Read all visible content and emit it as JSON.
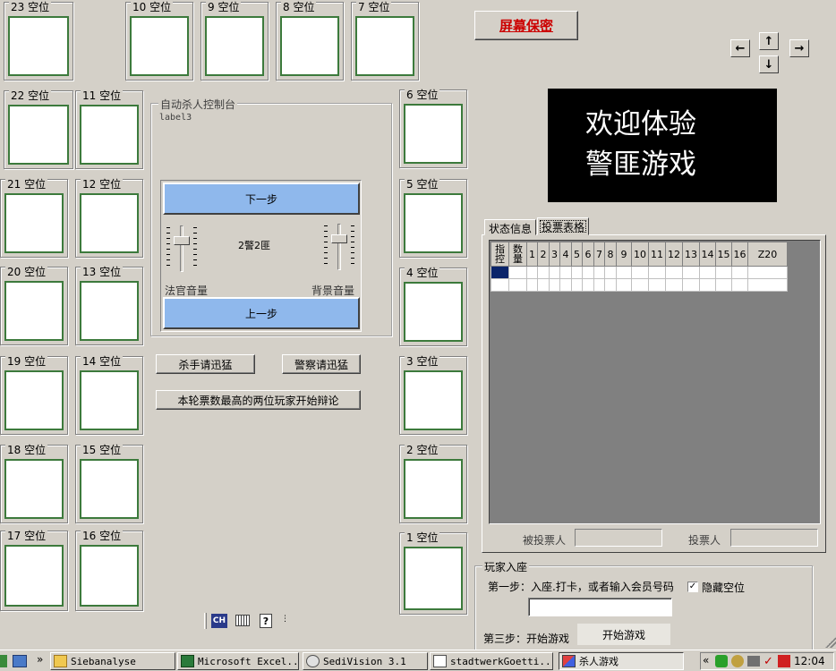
{
  "seats": [
    {
      "label": "23 空位"
    },
    {
      "label": "10 空位"
    },
    {
      "label": "9 空位"
    },
    {
      "label": "8 空位"
    },
    {
      "label": "7 空位"
    },
    {
      "label": "22 空位"
    },
    {
      "label": "11 空位"
    },
    {
      "label": "6 空位"
    },
    {
      "label": "21 空位"
    },
    {
      "label": "12 空位"
    },
    {
      "label": "5 空位"
    },
    {
      "label": "20 空位"
    },
    {
      "label": "13 空位"
    },
    {
      "label": "4 空位"
    },
    {
      "label": "19 空位"
    },
    {
      "label": "14 空位"
    },
    {
      "label": "3 空位"
    },
    {
      "label": "18 空位"
    },
    {
      "label": "15 空位"
    },
    {
      "label": "2 空位"
    },
    {
      "label": "17 空位"
    },
    {
      "label": "16 空位"
    },
    {
      "label": "1 空位"
    }
  ],
  "control": {
    "legend": "自动杀人控制台",
    "label3": "label3",
    "next_step": "下一步",
    "prev_step": "上一步",
    "status": "2警2匪",
    "judge_volume": "法官音量",
    "bg_volume": "背景音量",
    "judge_volume_level": 0.7,
    "bg_volume_level": 0.7
  },
  "actions": {
    "killer_fast": "杀手请迅猛",
    "police_fast": "警察请迅猛",
    "debate": "本轮票数最高的两位玩家开始辩论"
  },
  "screen_secret": "屏幕保密",
  "banner": {
    "line1": "欢迎体验",
    "line2": "警匪游戏"
  },
  "tabs": {
    "status": "状态信息",
    "vote": "投票表格"
  },
  "vote_table": {
    "col_control": "指控",
    "col_count": "数量",
    "col_nums": [
      "1",
      "2",
      "3",
      "4",
      "5",
      "6",
      "7",
      "8",
      "9",
      "10",
      "11",
      "12",
      "13",
      "14",
      "15",
      "16",
      "Z20"
    ]
  },
  "vote_fields": {
    "voted": "被投票人",
    "voter": "投票人"
  },
  "join": {
    "legend": "玩家入座",
    "step1": "第一步：入座.打卡，或者输入会员号码",
    "hide_empty": "隐藏空位",
    "hide_empty_checked": true,
    "step3": "第三步：开始游戏",
    "start": "开始游戏"
  },
  "ime": {
    "lang": "CH"
  },
  "taskbar": {
    "items": [
      "Siebanalyse",
      "Microsoft Excel...",
      "SediVision 3.1",
      "stadtwerkGoetti...",
      "杀人游戏"
    ],
    "chevron": "»",
    "tray_chevron": "«",
    "clock": "12:04"
  },
  "colors": {
    "bg": "#d4d0c8",
    "seat_border": "#3c7a3c",
    "button_blue": "#8fb8ec",
    "banner_bg": "#000000",
    "accent_red": "#cc0000",
    "selection": "#0a246a"
  }
}
